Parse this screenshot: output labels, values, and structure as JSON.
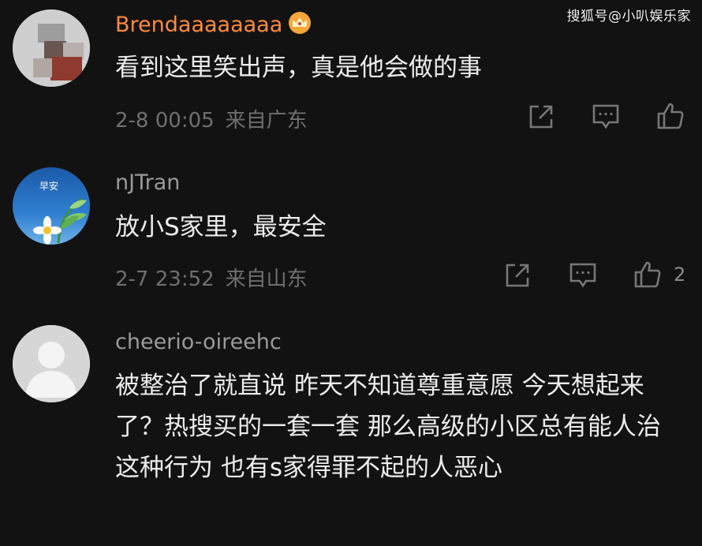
{
  "watermark": "搜狐号@小叭娱乐家",
  "comments": [
    {
      "username": "Brendaaaaaaaa",
      "text": "看到这里笑出声，真是他会做的事",
      "time": "2-8 00:05",
      "location": "来自广东",
      "likes": ""
    },
    {
      "username": "nJTran",
      "avatar_text": "早安",
      "text": "放小S家里，最安全",
      "time": "2-7 23:52",
      "location": "来自山东",
      "likes": "2"
    },
    {
      "username": "cheerio-oireehc",
      "text": "被整治了就直说 昨天不知道尊重意愿 今天想起来了？热搜买的一套一套 那么高级的小区总有能人治这种行为 也有s家得罪不起的人恶心",
      "time": "",
      "location": "",
      "likes": ""
    }
  ],
  "colors": {
    "background": "#121212",
    "vip_name": "#ff8a3d",
    "name": "#9a9a9a",
    "text": "#ececec",
    "meta": "#6f6f6f"
  },
  "icons": [
    "crown-icon",
    "share-icon",
    "comment-icon",
    "like-icon"
  ]
}
